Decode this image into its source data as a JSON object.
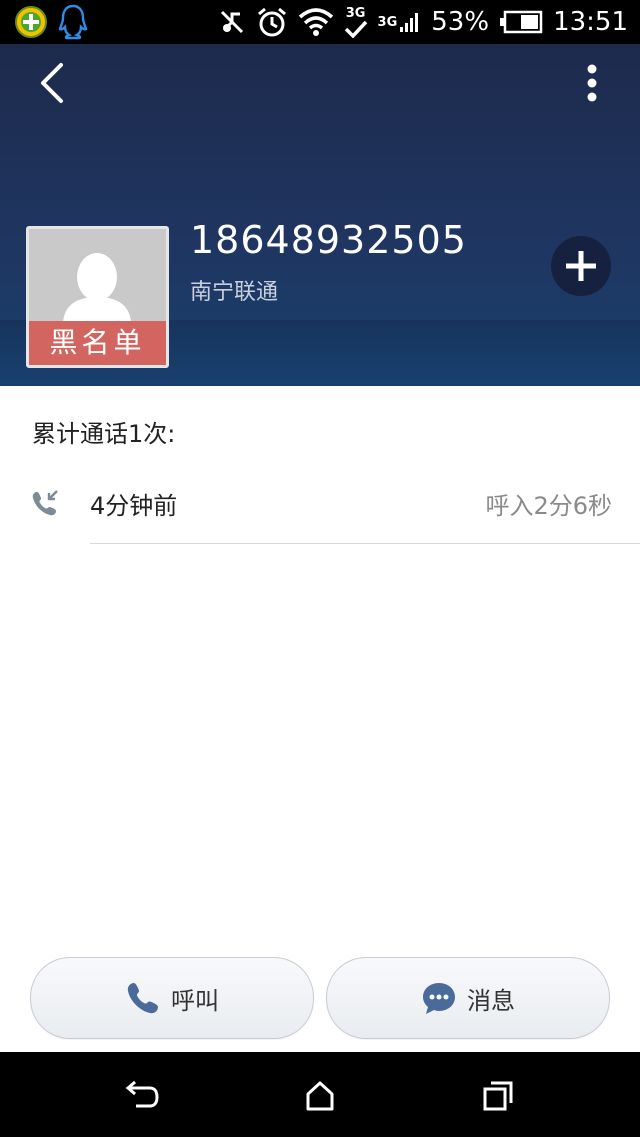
{
  "status_bar": {
    "battery_percent": "53%",
    "time": "13:51",
    "network_badge": "3G",
    "network_small": "3G"
  },
  "contact": {
    "phone_number": "18648932505",
    "carrier": "南宁联通",
    "blacklist_label": "黑名单"
  },
  "history": {
    "summary": "累计通话1次:",
    "calls": [
      {
        "time": "4分钟前",
        "detail": "呼入2分6秒",
        "icon": "incoming-call-icon"
      }
    ]
  },
  "actions": {
    "call_label": "呼叫",
    "message_label": "消息"
  },
  "colors": {
    "header_dark": "#1d2a4c",
    "blacklist_red": "#d26560",
    "accent_blue": "#4a6a9a"
  }
}
